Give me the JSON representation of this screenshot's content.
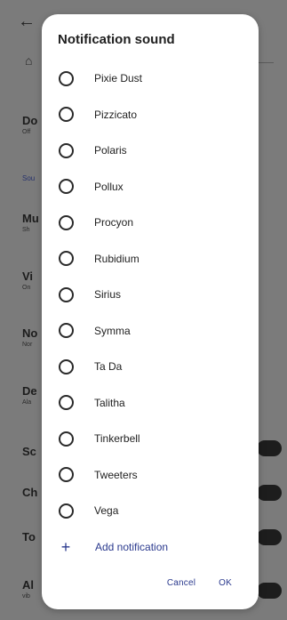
{
  "background": {
    "items": [
      {
        "title": "Do",
        "sub": "Off"
      },
      {
        "title": "Mu",
        "sub": "Sh"
      },
      {
        "title": "Vi",
        "sub": "On"
      },
      {
        "title": "No",
        "sub": "Nor"
      },
      {
        "title": "De",
        "sub": "Ala"
      },
      {
        "title": "Sc",
        "sub": ""
      },
      {
        "title": "Ch",
        "sub": ""
      },
      {
        "title": "To",
        "sub": ""
      },
      {
        "title": "Al",
        "sub": "vib"
      }
    ],
    "section_link": "Sou"
  },
  "dialog": {
    "title": "Notification sound",
    "options": [
      {
        "label": "Pixie Dust",
        "selected": false
      },
      {
        "label": "Pizzicato",
        "selected": false
      },
      {
        "label": "Polaris",
        "selected": false
      },
      {
        "label": "Pollux",
        "selected": false
      },
      {
        "label": "Procyon",
        "selected": false
      },
      {
        "label": "Rubidium",
        "selected": false
      },
      {
        "label": "Sirius",
        "selected": false
      },
      {
        "label": "Symma",
        "selected": false
      },
      {
        "label": "Ta Da",
        "selected": false
      },
      {
        "label": "Talitha",
        "selected": false
      },
      {
        "label": "Tinkerbell",
        "selected": false
      },
      {
        "label": "Tweeters",
        "selected": false
      },
      {
        "label": "Vega",
        "selected": false
      }
    ],
    "add_label": "Add notification",
    "cancel_label": "Cancel",
    "ok_label": "OK"
  },
  "colors": {
    "accent": "#2b3a8e",
    "scrim": "#7b7b7b"
  }
}
